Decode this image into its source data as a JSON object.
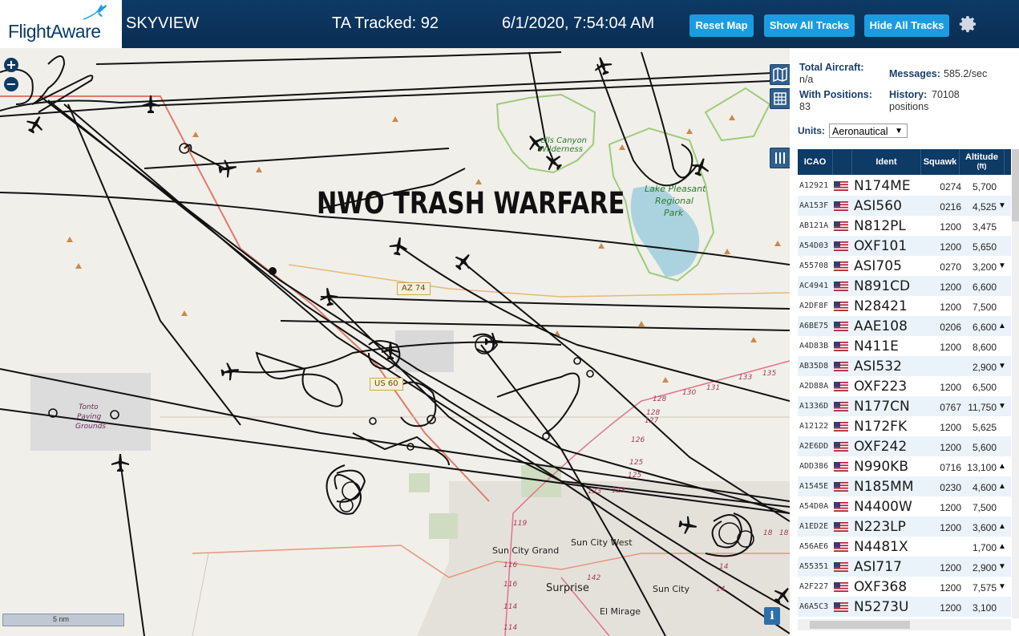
{
  "header": {
    "logo_text": "FlightAware",
    "app_name": "SKYVIEW",
    "tracked": "TA Tracked: 92",
    "datetime": "6/1/2020, 7:54:04 AM",
    "buttons": {
      "reset": "Reset Map",
      "show_all": "Show All Tracks",
      "hide_all": "Hide All Tracks"
    },
    "icons": {
      "settings": "gear-icon",
      "logo": "plane-icon"
    }
  },
  "map": {
    "overlay_title": "NWO TRASH WARFARE",
    "zoom_in": "+",
    "zoom_out": "−",
    "scale_label": "5 nm",
    "info": "i",
    "places": {
      "wilderness_1": "ells Canyon",
      "wilderness_2": "Wilderness",
      "lake_1": "Lake Pleasant",
      "lake_2": "Regional",
      "lake_3": "Park",
      "grounds_1": "Tonto",
      "grounds_2": "Paving",
      "grounds_3": "Grounds",
      "sun_city_grand": "Sun City Grand",
      "sun_city_west": "Sun City West",
      "surprise": "Surprise",
      "sun_city": "Sun City",
      "el_mirage": "El Mirage"
    },
    "shields": {
      "az74": "AZ 74",
      "us60": "US 60"
    },
    "route_numbers": [
      "128",
      "130",
      "131",
      "133",
      "135",
      "128",
      "127",
      "126",
      "125",
      "125",
      "123",
      "123",
      "119",
      "116",
      "116",
      "114",
      "114",
      "142",
      "18",
      "18",
      "14",
      "14"
    ],
    "icons": {
      "layers": "map-layers-icon",
      "grid": "grid-icon",
      "columns": "columns-icon"
    },
    "colors": {
      "tracks": "#111111",
      "water": "#aad3df",
      "highway": "#e07a6a",
      "park_border": "#9ccc7c"
    }
  },
  "panel": {
    "total_label": "Total Aircraft:",
    "total_value": "n/a",
    "messages_label": "Messages:",
    "messages_value": "585.2/sec",
    "positions_label": "With Positions:",
    "positions_value": "83",
    "history_label": "History:",
    "history_value": "70108",
    "history_unit": "positions",
    "units_label": "Units:",
    "units_value": "Aeronautical",
    "columns": {
      "icao": "ICAO",
      "ident": "Ident",
      "squawk": "Squawk",
      "altitude": "Altitude",
      "altitude_unit": "(ft)"
    },
    "rows": [
      {
        "icao": "A12921",
        "ident": "N174ME",
        "squawk": "0274",
        "alt": "5,700",
        "trend": ""
      },
      {
        "icao": "AA153F",
        "ident": "ASI560",
        "squawk": "0216",
        "alt": "4,525",
        "trend": "▼"
      },
      {
        "icao": "AB121A",
        "ident": "N812PL",
        "squawk": "1200",
        "alt": "3,475",
        "trend": ""
      },
      {
        "icao": "A54D03",
        "ident": "OXF101",
        "squawk": "1200",
        "alt": "5,650",
        "trend": ""
      },
      {
        "icao": "A55708",
        "ident": "ASI705",
        "squawk": "0270",
        "alt": "3,200",
        "trend": "▼"
      },
      {
        "icao": "AC4941",
        "ident": "N891CD",
        "squawk": "1200",
        "alt": "6,600",
        "trend": ""
      },
      {
        "icao": "A2DF8F",
        "ident": "N28421",
        "squawk": "1200",
        "alt": "7,500",
        "trend": ""
      },
      {
        "icao": "A6BE75",
        "ident": "AAE108",
        "squawk": "0206",
        "alt": "6,600",
        "trend": "▲"
      },
      {
        "icao": "A4D83B",
        "ident": "N411E",
        "squawk": "1200",
        "alt": "8,600",
        "trend": ""
      },
      {
        "icao": "AB35D8",
        "ident": "ASI532",
        "squawk": "",
        "alt": "2,900",
        "trend": "▼"
      },
      {
        "icao": "A2D88A",
        "ident": "OXF223",
        "squawk": "1200",
        "alt": "6,500",
        "trend": ""
      },
      {
        "icao": "A1336D",
        "ident": "N177CN",
        "squawk": "0767",
        "alt": "11,750",
        "trend": "▼"
      },
      {
        "icao": "A12122",
        "ident": "N172FK",
        "squawk": "1200",
        "alt": "5,625",
        "trend": ""
      },
      {
        "icao": "A2E6DD",
        "ident": "OXF242",
        "squawk": "1200",
        "alt": "5,600",
        "trend": ""
      },
      {
        "icao": "ADD386",
        "ident": "N990KB",
        "squawk": "0716",
        "alt": "13,100",
        "trend": "▲"
      },
      {
        "icao": "A1545E",
        "ident": "N185MM",
        "squawk": "0230",
        "alt": "4,600",
        "trend": "▲"
      },
      {
        "icao": "A54D0A",
        "ident": "N4400W",
        "squawk": "1200",
        "alt": "7,500",
        "trend": ""
      },
      {
        "icao": "A1ED2E",
        "ident": "N223LP",
        "squawk": "1200",
        "alt": "3,600",
        "trend": "▲"
      },
      {
        "icao": "A56AE6",
        "ident": "N4481X",
        "squawk": "",
        "alt": "1,700",
        "trend": "▲"
      },
      {
        "icao": "A55351",
        "ident": "ASI717",
        "squawk": "1200",
        "alt": "2,900",
        "trend": "▼"
      },
      {
        "icao": "A2F227",
        "ident": "OXF368",
        "squawk": "1200",
        "alt": "7,575",
        "trend": "▼"
      },
      {
        "icao": "A6A5C3",
        "ident": "N5273U",
        "squawk": "1200",
        "alt": "3,100",
        "trend": ""
      }
    ],
    "flag_icon": "us-flag-icon"
  }
}
